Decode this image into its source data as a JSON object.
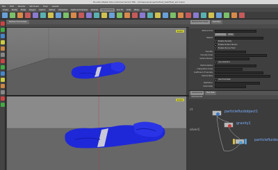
{
  "window": {
    "title": "Houdini Master Non-Commercial 9.0.786 - /home/user/projects/fluid_test/fluid_sim.hipnc"
  },
  "menubar": [
    "File",
    "Edit",
    "Render",
    "Windows",
    "Help",
    "Assets"
  ],
  "shelf_tabs": [
    {
      "label": "Create",
      "active": false
    },
    {
      "label": "Modify",
      "active": false
    },
    {
      "label": "Model",
      "active": false
    },
    {
      "label": "Polygon",
      "active": false
    },
    {
      "label": "Deform",
      "active": false
    },
    {
      "label": "Texture",
      "active": false
    },
    {
      "label": "Characters",
      "active": false
    },
    {
      "label": "Lights and Cameras",
      "active": false
    },
    {
      "label": "Particles",
      "active": false
    },
    {
      "label": "Viscous Fluids",
      "active": true
    },
    {
      "label": "Pyro FX",
      "active": false
    },
    {
      "label": "Cloth",
      "active": false
    },
    {
      "label": "Wires",
      "active": false
    },
    {
      "label": "Crowds",
      "active": false
    }
  ],
  "shelf_tool_colors": [
    "#6aa0d8",
    "#7bbf6a",
    "#d88a4a",
    "#c45a5a",
    "#8a7ad0",
    "#5ab0b0",
    "#d0c050",
    "#6aa0d8",
    "#7bbf6a",
    "#d88a4a",
    "#c45a5a",
    "#8a7ad0",
    "#5ab0b0",
    "#d0c050",
    "#6aa0d8",
    "#7bbf6a",
    "#d88a4a",
    "#c45a5a",
    "#8a7ad0",
    "#5ab0b0",
    "#d0c050",
    "#6aa0d8",
    "#7bbf6a",
    "#d88a4a",
    "#c45a5a",
    "#8a7ad0",
    "#5ab0b0",
    "#d0c050",
    "#6aa0d8",
    "#7bbf6a",
    "#d88a4a",
    "#c45a5a"
  ],
  "toolbox_colors": [
    "#c44",
    "#4a4",
    "#48c",
    "#cc4",
    "#c84",
    "#888",
    "#c44",
    "#4a4",
    "#48c",
    "#cc4",
    "#c84",
    "#888",
    "#c44",
    "#4a4"
  ],
  "viewer": {
    "tab_label": "Particle Fluid Solver",
    "top_camera": "persp1",
    "bottom_camera": "persp1"
  },
  "params": {
    "tabs": [
      {
        "label": "Particle Fluid Solver",
        "active": true
      },
      {
        "label": "Geometry",
        "active": false
      }
    ],
    "rows": [
      {
        "kind": "field",
        "label": "Particle Fluid"
      },
      {
        "kind": "subtabs",
        "items": [
          {
            "label": "Particle Fluid",
            "active": true
          },
          {
            "label": "Solver",
            "active": false
          }
        ]
      },
      {
        "kind": "field",
        "label": "Reseed"
      },
      {
        "kind": "check",
        "label": "Enable Viscosity"
      },
      {
        "kind": "check",
        "label": "Enable Surface Tension"
      },
      {
        "kind": "check",
        "label": "Enable Viscous Fluid"
      },
      {
        "kind": "field",
        "label": "Viscosity"
      },
      {
        "kind": "field",
        "label": "Viscosity Scale"
      },
      {
        "kind": "field",
        "label": "Surface Tension"
      },
      {
        "kind": "check",
        "label": "Use Advection"
      },
      {
        "kind": "field",
        "label": "Particle Radius"
      },
      {
        "kind": "field",
        "label": "Interpolation Scale"
      },
      {
        "kind": "field",
        "label": "Coefficient of Viscosity"
      },
      {
        "kind": "field",
        "label": "Particle Mass"
      },
      {
        "kind": "check",
        "label": "Use Fluid Ratio"
      },
      {
        "kind": "field",
        "label": "Restitution"
      },
      {
        "kind": "field",
        "label": "Initial State"
      }
    ]
  },
  "network": {
    "tabs": [
      {
        "label": "/obj/dopnet1",
        "active": true
      },
      {
        "label": "Tree View",
        "active": false
      }
    ],
    "path": "/obj/dopnet1",
    "side_label_top": "ct",
    "side_label_bottom": "olver1",
    "nodes": [
      {
        "name": "particlefluidobject1",
        "icon_color": "#3a78c8"
      },
      {
        "name": "gravity1",
        "icon_color": "#c83a3a"
      },
      {
        "name": "particlefluidso",
        "icon_color": "#4fa0d8"
      }
    ]
  }
}
